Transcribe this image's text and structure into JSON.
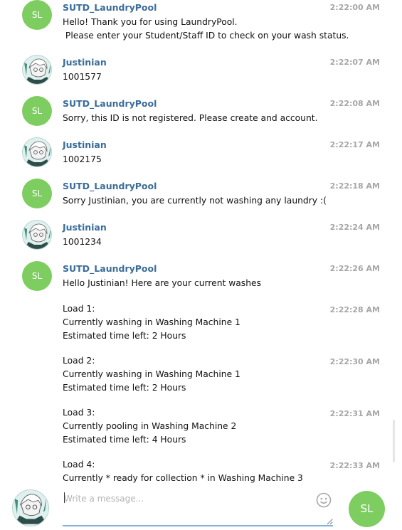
{
  "colors": {
    "accent": "#7dcd61",
    "sender_name": "#3a6d99",
    "timestamp": "#a6a6a6",
    "input_underline": "#7fb2d3"
  },
  "bot": {
    "name": "SUTD_LaundryPool",
    "initials": "SL"
  },
  "user": {
    "name": "Justinian",
    "avatar_icon": "anime-avatar-icon"
  },
  "messages": [
    {
      "sender": "SUTD_LaundryPool",
      "time": "2:22:00 AM",
      "text": "Hello! Thank you for using LaundryPool.\n Please enter your Student/Staff ID to check on your wash status."
    },
    {
      "sender": "Justinian",
      "time": "2:22:07 AM",
      "text": "1001577"
    },
    {
      "sender": "SUTD_LaundryPool",
      "time": "2:22:08 AM",
      "text": "Sorry, this ID is not registered. Please create and account."
    },
    {
      "sender": "Justinian",
      "time": "2:22:17 AM",
      "text": "1002175"
    },
    {
      "sender": "SUTD_LaundryPool",
      "time": "2:22:18 AM",
      "text": "Sorry Justinian, you are currently not washing any laundry :("
    },
    {
      "sender": "Justinian",
      "time": "2:22:24 AM",
      "text": "1001234"
    },
    {
      "sender": "SUTD_LaundryPool",
      "time": "2:22:26 AM",
      "text": "Hello Justinian! Here are your current washes"
    }
  ],
  "continuations": [
    {
      "time": "2:22:28 AM",
      "text": "Load 1:\nCurrently washing in Washing Machine 1\nEstimated time left: 2 Hours"
    },
    {
      "time": "2:22:30 AM",
      "text": "Load 2:\nCurrently washing in Washing Machine 1\nEstimated time left: 2 Hours"
    },
    {
      "time": "2:22:31 AM",
      "text": "Load 3:\nCurrently pooling in Washing Machine 2\nEstimated time left: 4 Hours"
    },
    {
      "time": "2:22:33 AM",
      "text": "Load 4:\nCurrently * ready for collection * in Washing Machine 3"
    }
  ],
  "composer": {
    "placeholder": "Write a message...",
    "value": "",
    "emoji_icon": "smiley-icon",
    "send_avatar_initials": "SL"
  }
}
